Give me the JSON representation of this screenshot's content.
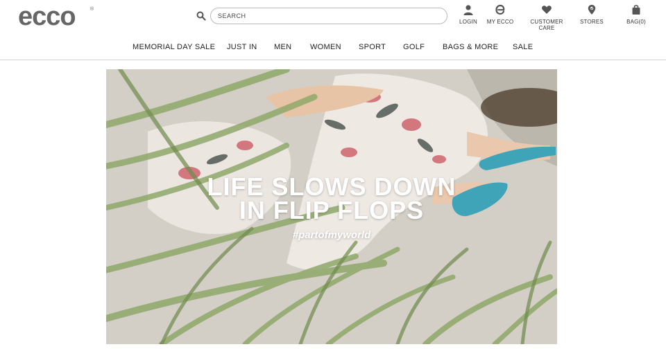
{
  "header": {
    "logo_text": "ecco",
    "logo_mark": "®",
    "search": {
      "placeholder": "SEARCH",
      "value": ""
    },
    "utilities": [
      {
        "label": "LOGIN",
        "icon": "person-icon"
      },
      {
        "label": "MY ECCO",
        "icon": "ecco-e-icon"
      },
      {
        "label": "CUSTOMER CARE",
        "icon": "heart-icon"
      },
      {
        "label": "STORES",
        "icon": "location-pin-icon"
      },
      {
        "label": "BAG(0)",
        "icon": "shopping-bag-icon"
      }
    ]
  },
  "nav": {
    "items": [
      {
        "label": "MEMORIAL DAY SALE"
      },
      {
        "label": "JUST IN"
      },
      {
        "label": "MEN"
      },
      {
        "label": "WOMEN"
      },
      {
        "label": "SPORT"
      },
      {
        "label": "GOLF"
      },
      {
        "label": "BAGS & MORE"
      },
      {
        "label": "SALE"
      }
    ]
  },
  "hero": {
    "title_line1": "LIFE SLOWS DOWN",
    "title_line2": "IN FLIP FLOPS",
    "hashtag": "#partofmyworld"
  },
  "colors": {
    "brand": "#666666",
    "nav_divider": "#cfcfcf",
    "flipflop": "#3fa4b8",
    "foliage": "#8fa86a"
  }
}
